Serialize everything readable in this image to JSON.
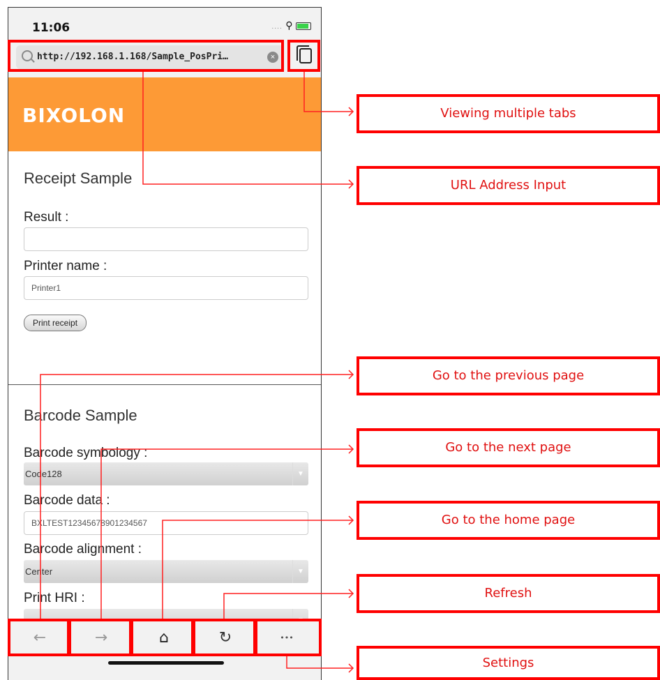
{
  "status_bar": {
    "time": "11:06",
    "signal": "....",
    "wifi": "wifi-icon",
    "battery": "battery-charging-icon"
  },
  "browser": {
    "url": "http://192.168.1.168/Sample_PosPri…",
    "clear_icon": "×",
    "tabs_icon": "tabs-icon"
  },
  "page": {
    "brand": "BIXOLON",
    "receipt": {
      "title": "Receipt Sample",
      "result_label": "Result :",
      "result_value": "",
      "printer_label": "Printer name :",
      "printer_value": "Printer1",
      "print_button": "Print receipt"
    },
    "barcode": {
      "title": "Barcode Sample",
      "symbology_label": "Barcode symbology :",
      "symbology_value": "Code128",
      "data_label": "Barcode data :",
      "data_value": "BXLTEST12345678901234567",
      "alignment_label": "Barcode alignment :",
      "alignment_value": "Center",
      "hri_label": "Print HRI :",
      "hri_value": ""
    }
  },
  "toolbar": {
    "back": "←",
    "forward": "→",
    "home": "⌂",
    "refresh": "↻",
    "more": "•••"
  },
  "callouts": {
    "tabs": "Viewing multiple tabs",
    "url": "URL Address Input",
    "back": "Go to the previous page",
    "forward": "Go to the next page",
    "home": "Go to the home page",
    "refresh": "Refresh",
    "settings": "Settings"
  },
  "colors": {
    "accent_red": "#ff0000",
    "brand_orange": "#fd9a36"
  }
}
